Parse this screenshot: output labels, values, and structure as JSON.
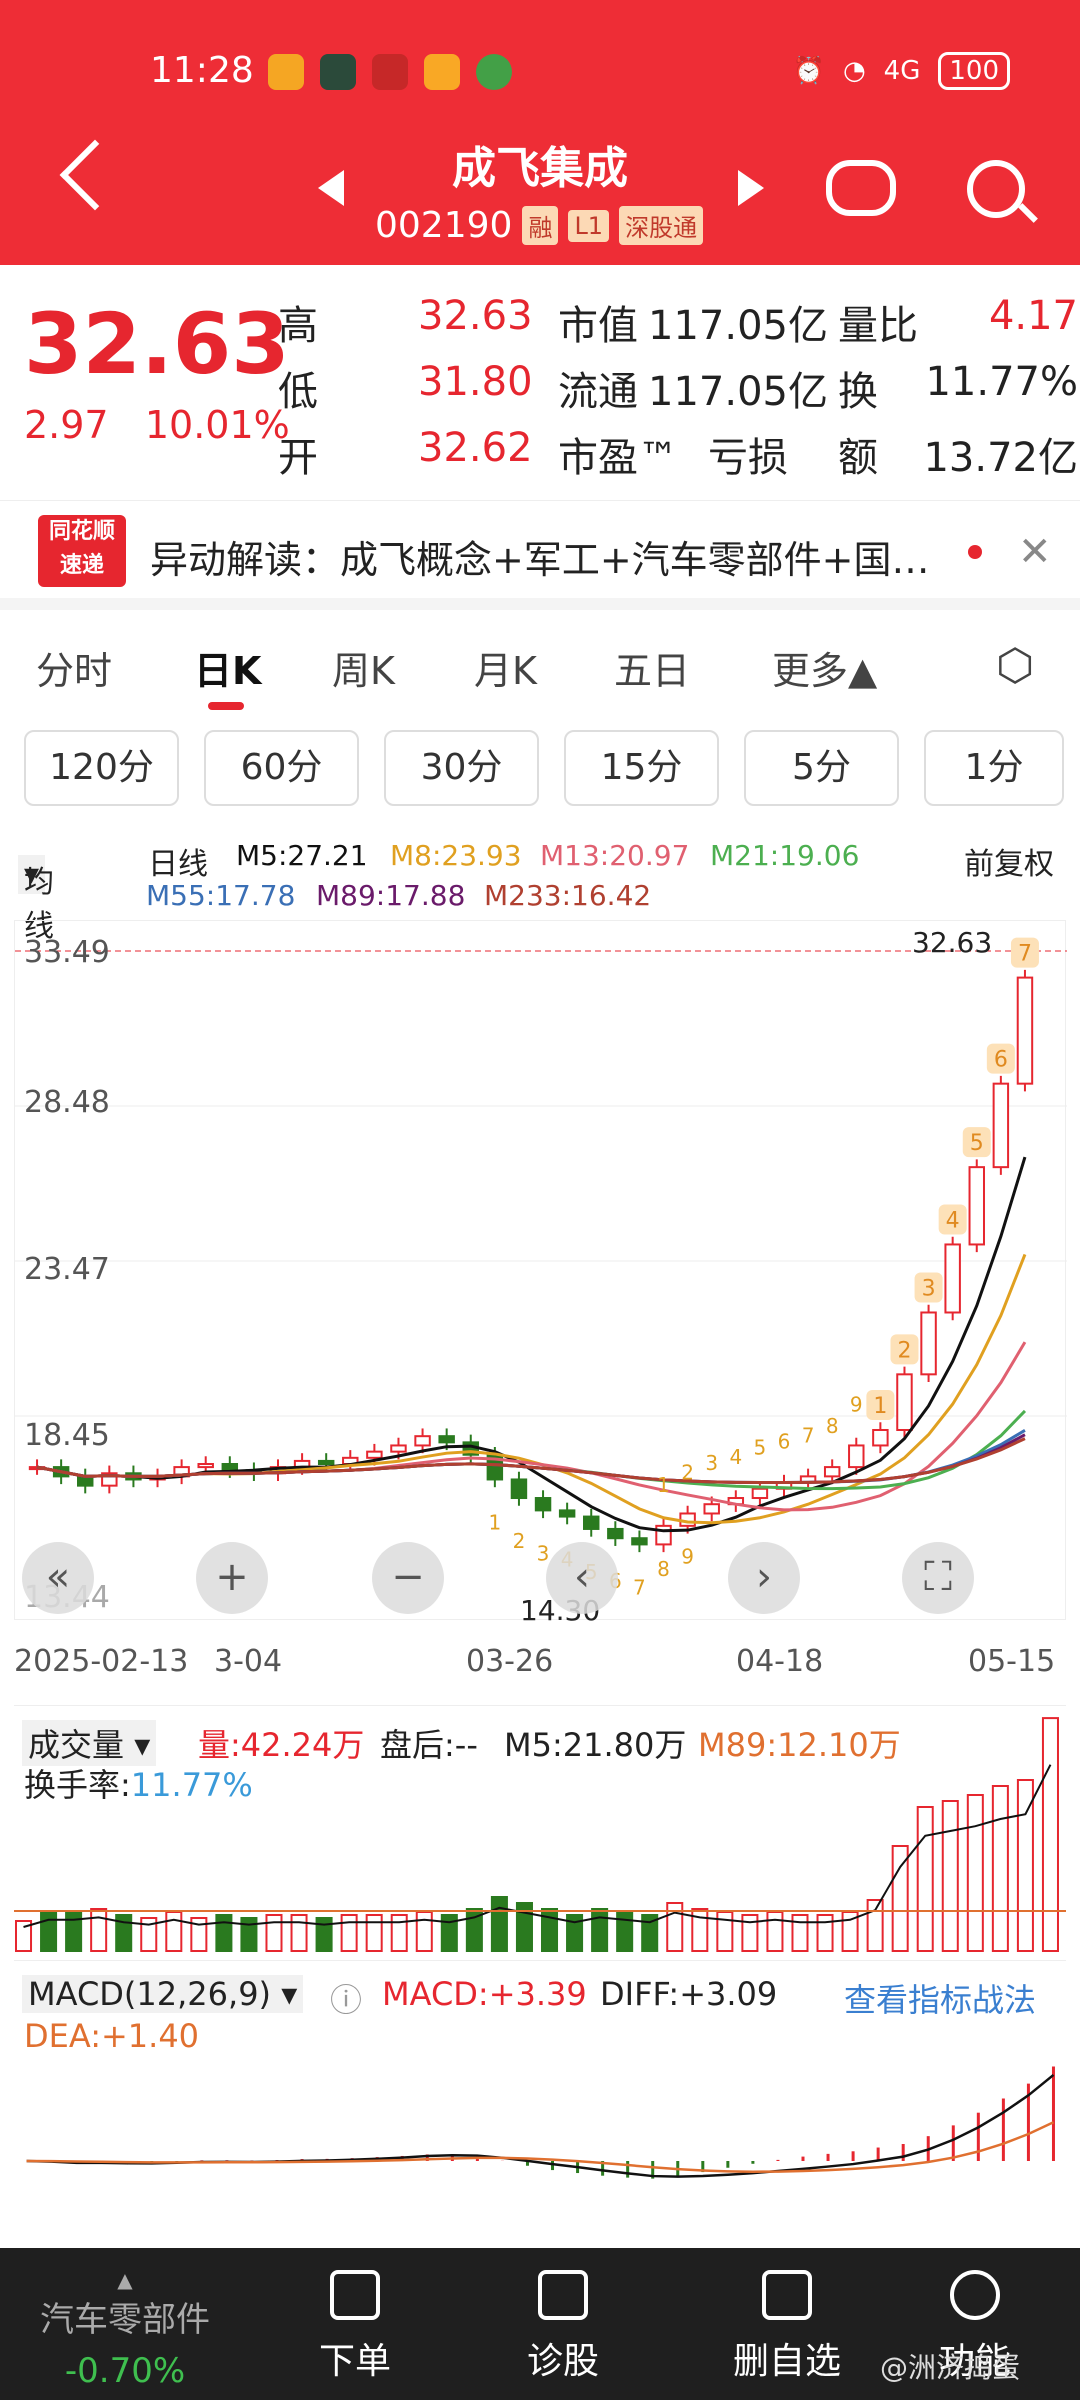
{
  "status": {
    "time": "11:28",
    "network": "4G",
    "battery": "100"
  },
  "header": {
    "title": "成飞集成",
    "code": "002190",
    "tags": [
      "融",
      "L1",
      "深股通"
    ]
  },
  "quote": {
    "price": "32.63",
    "change": "2.97",
    "change_pct": "10.01%",
    "rows": [
      {
        "l1": "高",
        "v1": "32.63",
        "l2": "市值",
        "v2": "117.05亿",
        "l3": "量比",
        "v3": "4.17"
      },
      {
        "l1": "低",
        "v1": "31.80",
        "l2": "流通",
        "v2": "117.05亿",
        "l3": "换",
        "v3": "11.77%"
      },
      {
        "l1": "开",
        "v1": "32.62",
        "l2": "市盈™",
        "v2": "亏损",
        "l3": "额",
        "v3": "13.72亿"
      }
    ]
  },
  "news": {
    "logo1": "同花顺",
    "logo2": "速递",
    "text": "异动解读：成飞概念+军工+汽车零部件+国…"
  },
  "tabs": {
    "items": [
      "分时",
      "日K",
      "周K",
      "月K",
      "五日",
      "更多▲"
    ]
  },
  "periods": [
    "120分",
    "60分",
    "30分",
    "15分",
    "5分",
    "1分"
  ],
  "ma": {
    "selector": "均线",
    "label": "日线",
    "m5": "M5:27.21",
    "m8": "M8:23.93",
    "m13": "M13:20.97",
    "m21": "M21:19.06",
    "m55": "M55:17.78",
    "m89": "M89:17.88",
    "m233": "M233:16.42",
    "adjust": "前复权"
  },
  "colors": {
    "up": "#e6262f",
    "down": "#2a7a1f",
    "m5": "#111111",
    "m8": "#e0a020",
    "m13": "#e06070",
    "m21": "#4caf50",
    "m55": "#3a6fb5",
    "m89": "#6a1b6a",
    "m233": "#b04030"
  },
  "chart_data": {
    "type": "candlestick",
    "y_ticks": [
      "33.49",
      "28.48",
      "23.47",
      "18.45",
      "13.44"
    ],
    "ylim": [
      13.44,
      33.49
    ],
    "x_ticks": [
      "2025-02-13",
      "3-04",
      "03-26",
      "04-18",
      "05-15"
    ],
    "max_label": "32.63",
    "min_label": "14.30",
    "closes": [
      16.8,
      16.5,
      16.2,
      16.6,
      16.4,
      16.5,
      16.8,
      16.9,
      16.7,
      16.6,
      16.8,
      17.0,
      16.9,
      17.1,
      17.3,
      17.5,
      17.8,
      17.6,
      17.2,
      16.4,
      15.8,
      15.4,
      15.2,
      14.8,
      14.5,
      14.3,
      14.9,
      15.3,
      15.6,
      15.8,
      16.1,
      16.3,
      16.5,
      16.8,
      17.5,
      18.0,
      19.8,
      21.8,
      24.0,
      26.5,
      29.2,
      32.63
    ],
    "td_top": [
      "1",
      "2",
      "3",
      "4",
      "5",
      "6",
      "7",
      "8",
      "9"
    ],
    "td_bottom": [
      "1",
      "2",
      "3",
      "4",
      "5",
      "6",
      "7",
      "8",
      "9"
    ],
    "td_recent": [
      "1",
      "2",
      "3",
      "4",
      "5",
      "6",
      "7"
    ]
  },
  "volume": {
    "selector": "成交量",
    "vol": "量:42.24万",
    "after": "盘后:--",
    "m5": "M5:21.80万",
    "m89": "M89:12.10万",
    "turnover_label": "换手率:",
    "turnover": "11.77%"
  },
  "macd": {
    "selector": "MACD(12,26,9)",
    "macd": "MACD:+3.39",
    "diff": "DIFF:+3.09",
    "dea": "DEA:+1.40",
    "link": "查看指标战法"
  },
  "bottom": {
    "sector": "汽车零部件",
    "sector_change": "-0.70%",
    "items": [
      "下单",
      "诊股",
      "删自选",
      "功能"
    ],
    "watermark": "@洲济捣蛋"
  }
}
